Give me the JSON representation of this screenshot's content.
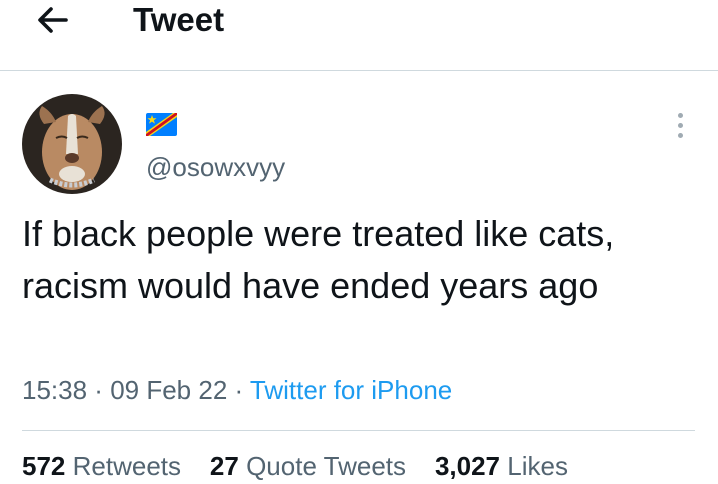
{
  "header": {
    "title": "Tweet",
    "back_icon": "arrow-left-icon"
  },
  "tweet": {
    "handle": "@osowxvyy",
    "flag_icon": "drc-flag-icon",
    "text": "If black people were treated like cats, racism would have ended years ago",
    "time": "15:38",
    "date": "09 Feb 22",
    "separator": " · ",
    "source": "Twitter for iPhone"
  },
  "stats": {
    "retweets_count": "572",
    "retweets_label": "Retweets",
    "quotes_count": "27",
    "quotes_label": "Quote Tweets",
    "likes_count": "3,027",
    "likes_label": "Likes"
  },
  "colors": {
    "accent": "#1d9bf0",
    "secondary_text": "#536471",
    "divider": "#cfd9de"
  }
}
